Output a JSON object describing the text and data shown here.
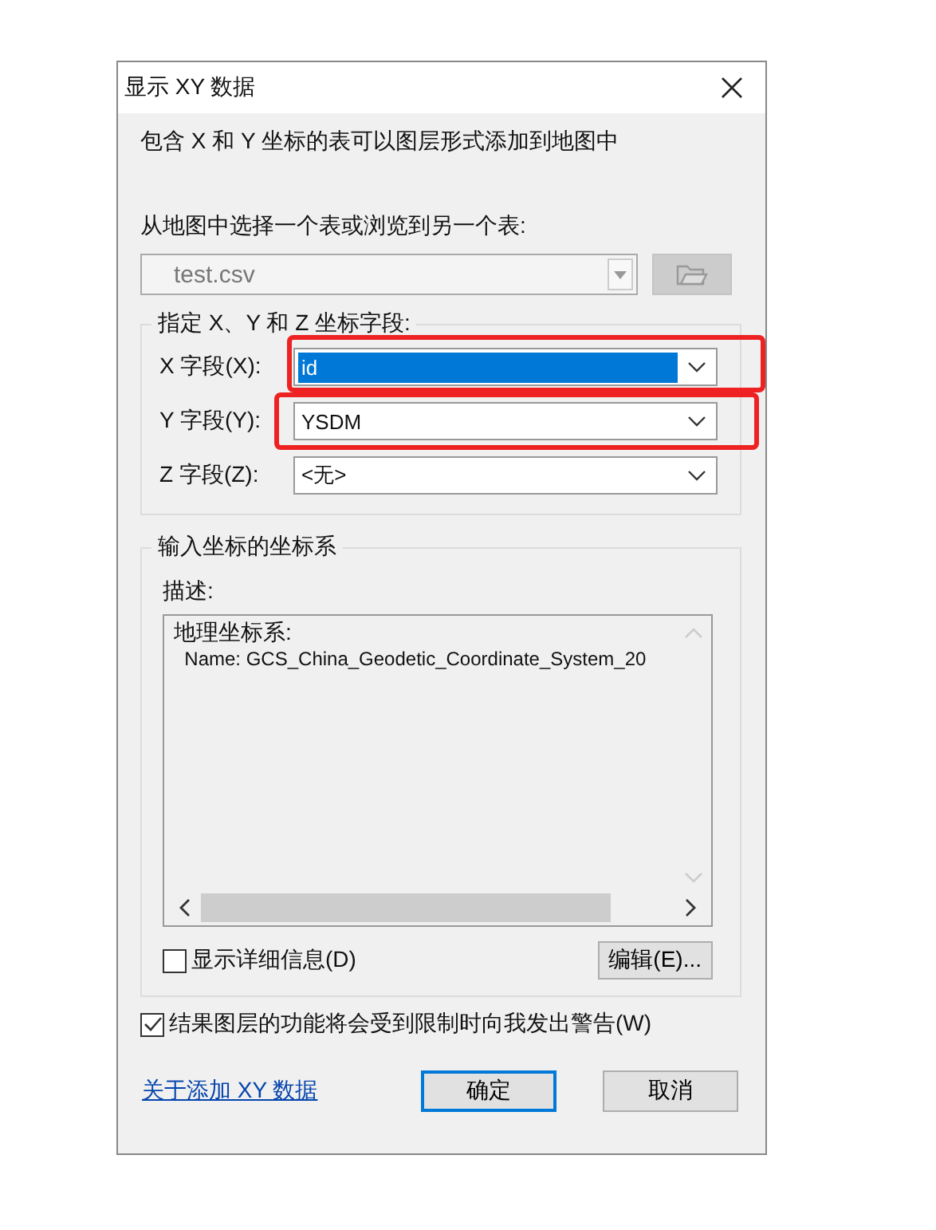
{
  "window": {
    "title": "显示 XY 数据"
  },
  "intro": "包含 X 和 Y 坐标的表可以图层形式添加到地图中",
  "table_label": "从地图中选择一个表或浏览到另一个表:",
  "table_combo": {
    "value": "test.csv",
    "disabled": true
  },
  "fields_group": {
    "title": "指定 X、Y 和 Z 坐标字段:",
    "fields": [
      {
        "label": "X 字段(X):",
        "value": "id",
        "selected": true,
        "highlighted": true
      },
      {
        "label": "Y 字段(Y):",
        "value": "YSDM",
        "selected": false,
        "highlighted": true
      },
      {
        "label": "Z 字段(Z):",
        "value": "<无>",
        "selected": false,
        "highlighted": false
      }
    ]
  },
  "coordinate_group": {
    "title": "输入坐标的坐标系",
    "description_label": "描述:",
    "description_lines": [
      "地理坐标系:",
      "  Name: GCS_China_Geodetic_Coordinate_System_20"
    ],
    "show_details": {
      "label": "显示详细信息(D)",
      "checked": false
    },
    "edit_button": "编辑(E)..."
  },
  "warn_checkbox": {
    "label": "结果图层的功能将会受到限制时向我发出警告(W)",
    "checked": true
  },
  "help_link": "关于添加 XY 数据",
  "buttons": [
    {
      "label": "确定",
      "default": true
    },
    {
      "label": "取消",
      "default": false
    }
  ]
}
